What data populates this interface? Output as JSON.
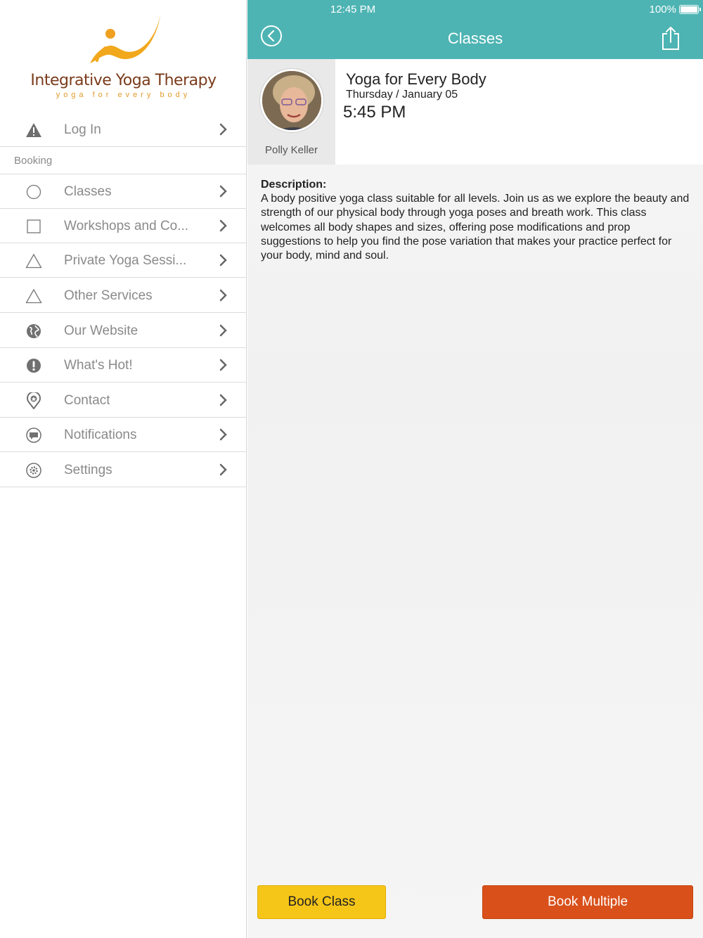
{
  "status_bar": {
    "time": "12:45 PM",
    "battery": "100%"
  },
  "logo": {
    "title": "Integrative Yoga Therapy",
    "tagline": "yoga for every body"
  },
  "sidebar": {
    "login": {
      "label": "Log In",
      "icon": "warning-icon"
    },
    "section_label": "Booking",
    "items": [
      {
        "label": "Classes",
        "icon": "circle-icon"
      },
      {
        "label": "Workshops and Co...",
        "icon": "square-icon"
      },
      {
        "label": "Private Yoga Sessi...",
        "icon": "triangle-icon"
      },
      {
        "label": "Other Services",
        "icon": "triangle-icon"
      },
      {
        "label": "Our Website",
        "icon": "globe-icon"
      },
      {
        "label": "What's Hot!",
        "icon": "exclamation-icon"
      },
      {
        "label": "Contact",
        "icon": "location-pin-icon"
      },
      {
        "label": "Notifications",
        "icon": "chat-bubble-icon"
      },
      {
        "label": "Settings",
        "icon": "gear-icon"
      }
    ]
  },
  "header": {
    "title": "Classes"
  },
  "class": {
    "instructor": "Polly Keller",
    "title": "Yoga for Every Body",
    "date": "Thursday / January 05",
    "time": "5:45 PM",
    "description_label": "Description:",
    "description": "A body positive yoga class suitable for all levels. Join us as we explore the beauty and strength of our physical body through yoga poses and breath work. This class welcomes all body shapes and sizes, offering pose modifications and prop suggestions to help you find the pose variation that makes your practice perfect for your body, mind and soul."
  },
  "actions": {
    "book_class": "Book Class",
    "book_multiple": "Book Multiple"
  },
  "colors": {
    "accent": "#4db4b3",
    "book_class": "#f5c518",
    "book_multiple": "#d9501a"
  }
}
